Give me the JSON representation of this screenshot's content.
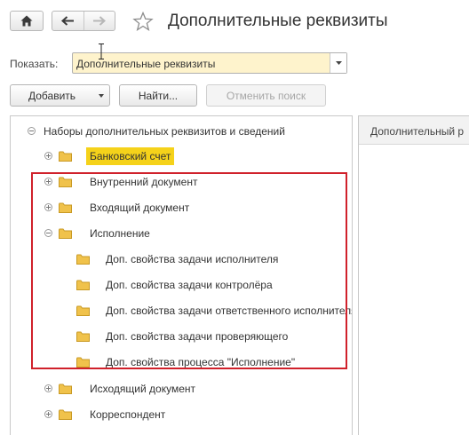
{
  "header": {
    "title": "Дополнительные реквизиты"
  },
  "filter": {
    "label": "Показать:",
    "value": "Дополнительные реквизиты"
  },
  "toolbar": {
    "add_label": "Добавить",
    "find_label": "Найти...",
    "cancel_search_label": "Отменить поиск"
  },
  "right_panel": {
    "header": "Дополнительный р"
  },
  "tree": {
    "root": "Наборы дополнительных реквизитов и сведений",
    "items": [
      {
        "label": "Банковский счет"
      },
      {
        "label": "Внутренний документ"
      },
      {
        "label": "Входящий документ"
      },
      {
        "label": "Исполнение"
      },
      {
        "label": "Доп. свойства задачи исполнителя"
      },
      {
        "label": "Доп. свойства задачи контролёра"
      },
      {
        "label": "Доп. свойства задачи ответственного исполнителя"
      },
      {
        "label": "Доп. свойства задачи проверяющего"
      },
      {
        "label": "Доп. свойства процесса \"Исполнение\""
      },
      {
        "label": "Исходящий документ"
      },
      {
        "label": "Корреспондент"
      }
    ]
  },
  "colors": {
    "selection": "#f5d21a",
    "highlight_frame": "#d0212b",
    "input_bg": "#fef3cc"
  },
  "icons": [
    "home-icon",
    "back-arrow-icon",
    "forward-arrow-icon",
    "star-icon",
    "dropdown-arrow-icon",
    "folder-icon",
    "expand-icon",
    "collapse-icon"
  ]
}
